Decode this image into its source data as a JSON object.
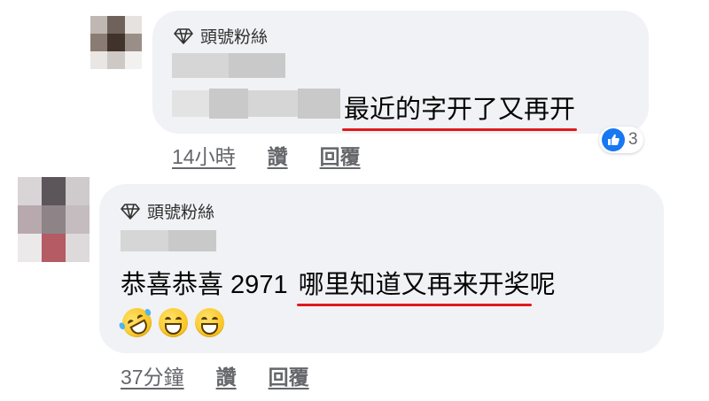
{
  "comments": [
    {
      "badge": "頭號粉絲",
      "author_name_redacted": true,
      "text_prefix_redacted": true,
      "text_highlight": "最近的字开了又再开",
      "time": "14小時",
      "like_label": "讚",
      "reply_label": "回覆",
      "reaction_count": "3",
      "reaction_icon": "like-icon"
    },
    {
      "badge": "頭號粉絲",
      "author_name_redacted": true,
      "text_prefix": "恭喜恭喜 2971",
      "text_highlight": "哪里知道又再来开奖",
      "text_suffix": "呢",
      "emojis": [
        "rolling-on-floor-laughing-icon",
        "grinning-face-icon",
        "grinning-face-icon"
      ],
      "time": "37分鐘",
      "like_label": "讚",
      "reply_label": "回覆"
    }
  ],
  "colors": {
    "bubble": "#f0f2f5",
    "highlight_underline": "#e0191c",
    "meta_text": "#65676b",
    "like_blue": "#1877f2"
  }
}
